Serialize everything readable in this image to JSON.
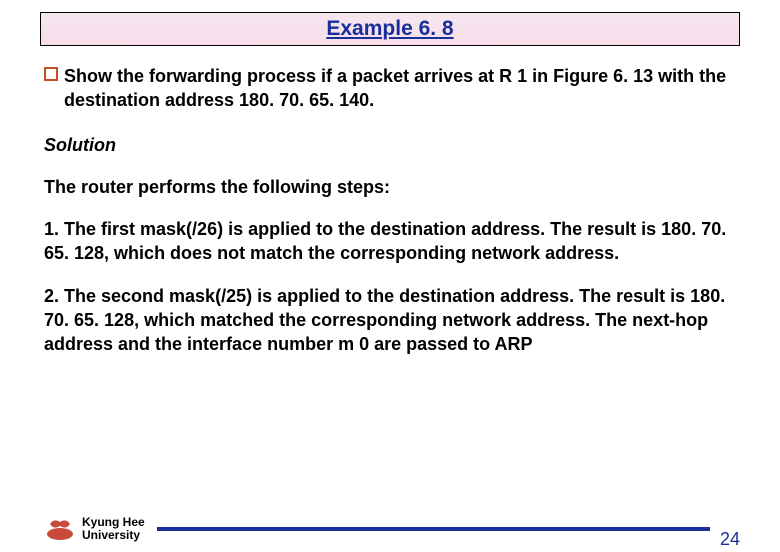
{
  "title": "Example 6. 8",
  "bullet": "Show the forwarding process if a packet arrives at R 1 in Figure 6. 13 with the destination address 180. 70. 65. 140.",
  "solution_label": "Solution",
  "intro": "The router performs the following steps:",
  "step1": "1. The first mask(/26) is applied to the destination address. The result is 180. 70. 65. 128, which does not match the corresponding network address.",
  "step2": "2. The second mask(/25) is applied to the destination address. The result is 180. 70. 65. 128, which matched the corresponding network address. The next-hop address and the interface number m 0 are passed to ARP",
  "university_line1": "Kyung Hee",
  "university_line2": "University",
  "page_number": "24"
}
